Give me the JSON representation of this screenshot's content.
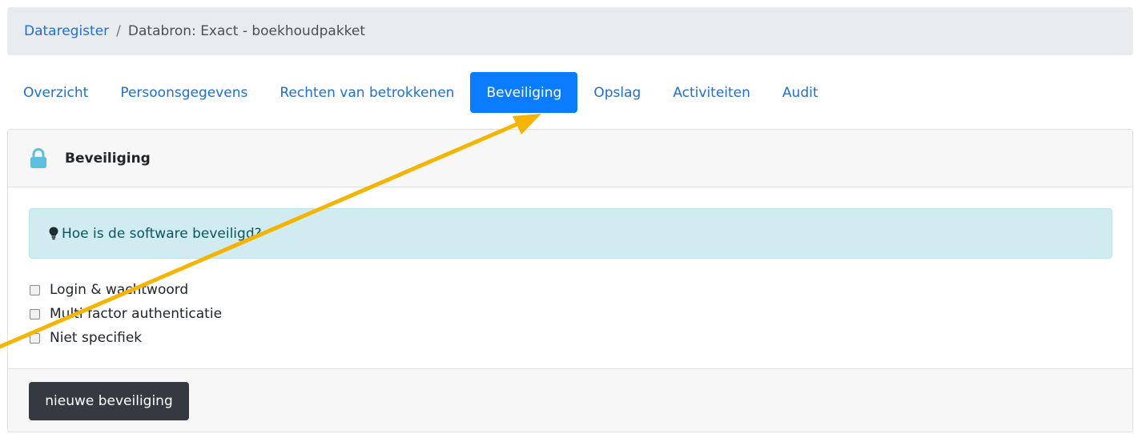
{
  "breadcrumb": {
    "items": [
      {
        "label": "Dataregister"
      },
      {
        "label": "Databron: Exact - boekhoudpakket"
      }
    ],
    "separator": "/"
  },
  "tabs": [
    {
      "label": "Overzicht",
      "active": false
    },
    {
      "label": "Persoonsgegevens",
      "active": false
    },
    {
      "label": "Rechten van betrokkenen",
      "active": false
    },
    {
      "label": "Beveiliging",
      "active": true
    },
    {
      "label": "Opslag",
      "active": false
    },
    {
      "label": "Activiteiten",
      "active": false
    },
    {
      "label": "Audit",
      "active": false
    }
  ],
  "card": {
    "title": "Beveiliging",
    "icon": "lock-icon",
    "alert": {
      "icon": "lightbulb-icon",
      "text": "Hoe is de software beveiligd?"
    },
    "options": [
      {
        "label": "Login & wachtwoord",
        "checked": false
      },
      {
        "label": "Multi factor authenticatie",
        "checked": false
      },
      {
        "label": "Niet specifiek",
        "checked": false
      }
    ],
    "footer": {
      "button_label": "nieuwe beveiliging"
    }
  },
  "annotation": {
    "type": "arrow",
    "color": "#f5b400"
  },
  "colors": {
    "link": "#1e6fd9",
    "active_tab": "#0a7cff",
    "alert_bg": "#d1ecf1",
    "alert_text": "#0c5460",
    "button_bg": "#343a40",
    "lock_icon": "#5bc0de"
  }
}
